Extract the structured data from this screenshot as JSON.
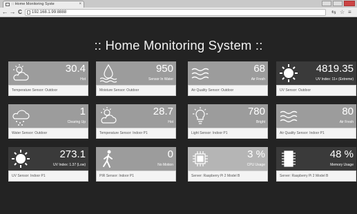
{
  "browser": {
    "tab_title": ":: Home Monitoring Syste",
    "tab_close": "×",
    "url": "192.168.1.99:8888",
    "back": "←",
    "forward": "→",
    "reload": "C"
  },
  "page": {
    "title": ":: Home Monitoring System ::"
  },
  "cards": [
    {
      "value": "30.4",
      "status": "Hot",
      "label": "Temperature Sensor: Outdoor",
      "icon": "sun-cloud-icon"
    },
    {
      "value": "950",
      "status": "Sensor In Water",
      "label": "Moisture Sensor: Outdoor",
      "icon": "water-drop-icon"
    },
    {
      "value": "68",
      "status": "Air Fresh",
      "label": "Air Quality Sensor: Outdoor",
      "icon": "wind-icon"
    },
    {
      "value": "4819.35",
      "status": "UV Index: 11+ (Extreme)",
      "label": "UV Sensor: Outdoor",
      "icon": "sun-icon"
    },
    {
      "value": "1",
      "status": "Clearing Up",
      "label": "Water Sensor: Outdoor",
      "icon": "rain-cloud-icon"
    },
    {
      "value": "28.7",
      "status": "Hot",
      "label": "Temperature Sensor: Indoor P1",
      "icon": "sun-cloud-icon"
    },
    {
      "value": "780",
      "status": "Bright",
      "label": "Light Sensor: Indoor P1",
      "icon": "light-bulb-icon"
    },
    {
      "value": "80",
      "status": "Air Fresh",
      "label": "Air Quality Sensor: Indoor P1",
      "icon": "wind-icon"
    },
    {
      "value": "273.1",
      "status": "UV Index: 1.37 (Low)",
      "label": "UV Sensor: Indoor P1",
      "icon": "sun-icon"
    },
    {
      "value": "0",
      "status": "No Motion",
      "label": "PIR Sensor: Indoor P1",
      "icon": "walking-person-icon"
    },
    {
      "value": "3 %",
      "status": "CPU Usage",
      "label": "Server: Raspberry Pi 2 Model B",
      "icon": "cpu-chip-icon"
    },
    {
      "value": "48 %",
      "status": "Memory Usage",
      "label": "Server: Raspberry Pi 2 Model B",
      "icon": "memory-chip-icon"
    }
  ]
}
